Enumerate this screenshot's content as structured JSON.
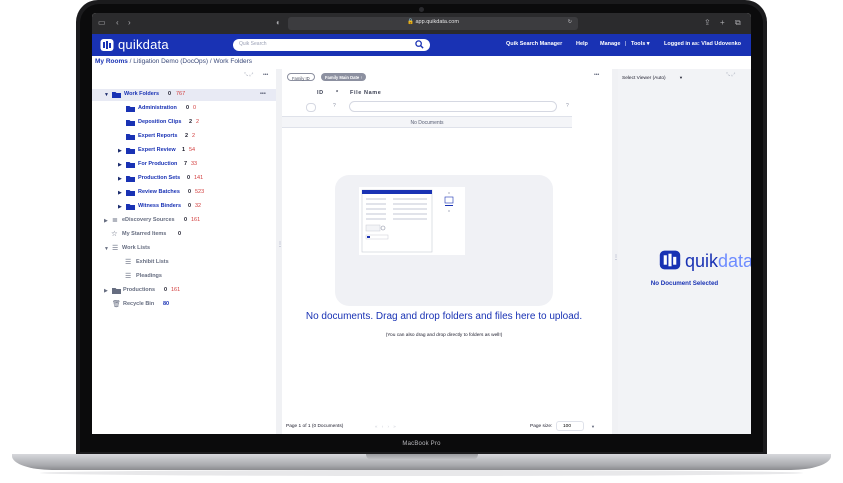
{
  "device": {
    "model_label": "MacBook Pro"
  },
  "browser": {
    "url": "app.quikdata.com"
  },
  "header": {
    "brand": "quikdata",
    "search_placeholder": "Quik Search",
    "nav": {
      "quik_search_manager": "Quik Search Manager",
      "help": "Help",
      "manage": "Manage",
      "separator": "|",
      "tools": "Tools ▾",
      "logged_in": "Logged in as: Vlad Udovenko"
    }
  },
  "breadcrumb": {
    "root": "My Rooms",
    "path": " / Litigation Demo (DocOps) / Work Folders"
  },
  "tree": {
    "work_folders": {
      "label": "Work Folders",
      "c1": "0",
      "c2": "767"
    },
    "administration": {
      "label": "Administration",
      "c1": "0",
      "c2": "0"
    },
    "deposition_clips": {
      "label": "Deposition Clips",
      "c1": "2",
      "c2": "2"
    },
    "expert_reports": {
      "label": "Expert Reports",
      "c1": "2",
      "c2": "2"
    },
    "expert_review": {
      "label": "Expert Review",
      "c1": "1",
      "c2": "54"
    },
    "for_production": {
      "label": "For Production",
      "c1": "7",
      "c2": "33"
    },
    "production_sets": {
      "label": "Production Sets",
      "c1": "0",
      "c2": "141"
    },
    "review_batches": {
      "label": "Review Batches",
      "c1": "0",
      "c2": "523"
    },
    "witness_binders": {
      "label": "Witness Binders",
      "c1": "0",
      "c2": "32"
    },
    "ediscovery_sources": {
      "label": "eDiscovery Sources",
      "c1": "0",
      "c2": "161"
    },
    "my_starred_items": {
      "label": "My Starred Items",
      "c1": "0"
    },
    "work_lists": {
      "label": "Work Lists"
    },
    "exhibit_lists": {
      "label": "Exhibit Lists"
    },
    "pleadings": {
      "label": "Pleadings"
    },
    "productions": {
      "label": "Productions",
      "c1": "0",
      "c2": "161"
    },
    "recycle_bin": {
      "label": "Recycle Bin",
      "c1": "80"
    },
    "more": "•••"
  },
  "documents": {
    "chips": {
      "family_id": "Family ID",
      "family_main_date": "Family Main Date ↑"
    },
    "columns": {
      "id": "ID",
      "star": "*",
      "file_name": "File Name"
    },
    "filter_help": "?",
    "empty_bar": "No Documents",
    "drop_main": "No documents. Drag and drop folders and files here to upload.",
    "drop_sub": "(You can also drag and drop directly to folders as well!)",
    "pager_text": "Page 1 of 1 (0 Documents)",
    "pager_nav": "« ‹ › »",
    "page_size_label": "Page size:",
    "page_size": "100",
    "more": "•••"
  },
  "viewer": {
    "select_label": "Select Viewer (Auto)",
    "brand_a": "quik",
    "brand_b": "data",
    "empty": "No Document Selected"
  },
  "colors": {
    "brand": "#1932b4",
    "accent_red": "#d23c3c",
    "panel_bg": "#f2f3f6"
  }
}
